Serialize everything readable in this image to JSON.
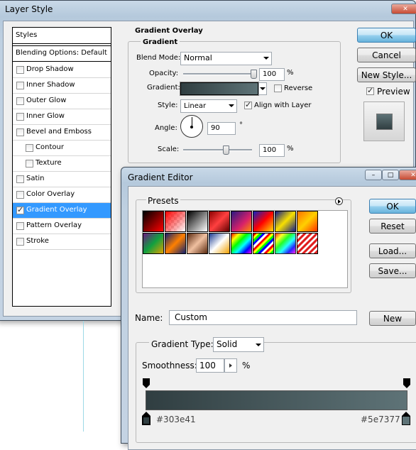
{
  "layer_style": {
    "title": "Layer Style",
    "styles_header": "Styles",
    "blending_options": "Blending Options: Default",
    "items": [
      {
        "label": "Drop Shadow",
        "checked": false,
        "indent": false,
        "selected": false
      },
      {
        "label": "Inner Shadow",
        "checked": false,
        "indent": false,
        "selected": false
      },
      {
        "label": "Outer Glow",
        "checked": false,
        "indent": false,
        "selected": false
      },
      {
        "label": "Inner Glow",
        "checked": false,
        "indent": false,
        "selected": false
      },
      {
        "label": "Bevel and Emboss",
        "checked": false,
        "indent": false,
        "selected": false
      },
      {
        "label": "Contour",
        "checked": false,
        "indent": true,
        "selected": false
      },
      {
        "label": "Texture",
        "checked": false,
        "indent": true,
        "selected": false
      },
      {
        "label": "Satin",
        "checked": false,
        "indent": false,
        "selected": false
      },
      {
        "label": "Color Overlay",
        "checked": false,
        "indent": false,
        "selected": false
      },
      {
        "label": "Gradient Overlay",
        "checked": true,
        "indent": false,
        "selected": true
      },
      {
        "label": "Pattern Overlay",
        "checked": false,
        "indent": false,
        "selected": false
      },
      {
        "label": "Stroke",
        "checked": false,
        "indent": false,
        "selected": false
      }
    ],
    "section_title": "Gradient Overlay",
    "group_title": "Gradient",
    "blend_mode_label": "Blend Mode:",
    "blend_mode_value": "Normal",
    "opacity_label": "Opacity:",
    "opacity_value": "100",
    "percent": "%",
    "gradient_label": "Gradient:",
    "reverse_label": "Reverse",
    "style_label": "Style:",
    "style_value": "Linear",
    "align_label": "Align with Layer",
    "angle_label": "Angle:",
    "angle_value": "90",
    "degree": "°",
    "scale_label": "Scale:",
    "scale_value": "100",
    "ok": "OK",
    "cancel": "Cancel",
    "new_style": "New Style...",
    "preview_label": "Preview",
    "opacity_level": 1.0,
    "scale_level": 0.62
  },
  "gradient_editor": {
    "title": "Gradient Editor",
    "presets_label": "Presets",
    "ok": "OK",
    "reset": "Reset",
    "load": "Load...",
    "save": "Save...",
    "name_label": "Name:",
    "name_value": "Custom",
    "new": "New",
    "gradient_type_label": "Gradient Type:",
    "gradient_type_value": "Solid",
    "smoothness_label": "Smoothness:",
    "smoothness_value": "100",
    "percent": "%",
    "stop_left_color": "#303e41",
    "stop_right_color": "#5e7377",
    "window_buttons": [
      "–",
      "□",
      "✕"
    ]
  },
  "colors": {
    "gradient_start": "#303e41",
    "gradient_end": "#5e7377",
    "selection": "#3399ff"
  }
}
